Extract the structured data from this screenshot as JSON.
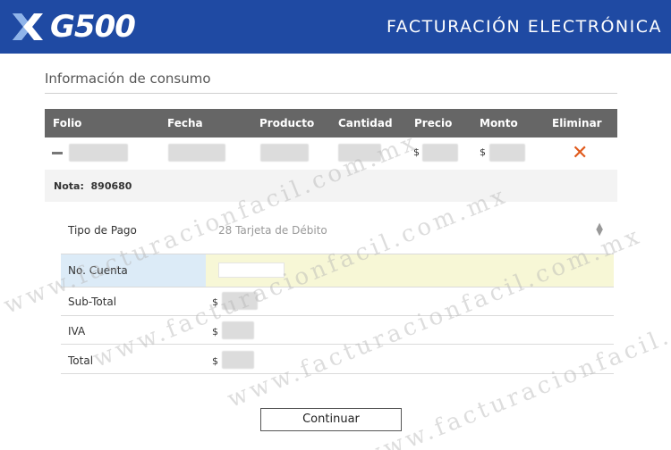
{
  "header": {
    "logo_text": "G500",
    "title": "FACTURACIÓN ELECTRÓNICA"
  },
  "section": {
    "title": "Información de consumo"
  },
  "table": {
    "columns": [
      "Folio",
      "Fecha",
      "Producto",
      "Cantidad",
      "Precio",
      "Monto",
      "Eliminar"
    ],
    "row": {
      "precio_currency": "$",
      "monto_currency": "$"
    }
  },
  "nota": {
    "label": "Nota:",
    "value": "890680"
  },
  "form": {
    "tipo_pago_label": "Tipo de Pago",
    "tipo_pago_value": "28 Tarjeta de Débito",
    "cuenta_label": "No. Cuenta",
    "subtotal_label": "Sub-Total",
    "iva_label": "IVA",
    "total_label": "Total",
    "currency": "$"
  },
  "actions": {
    "continue_label": "Continuar"
  },
  "watermark": {
    "text": "www.facturacionfacil.com.mx"
  },
  "colors": {
    "brand_blue": "#1f4aa3",
    "header_gray": "#666666",
    "delete_orange": "#e05a1c",
    "account_label_bg": "#dcebf7",
    "account_input_bg": "#f7f7d6"
  }
}
